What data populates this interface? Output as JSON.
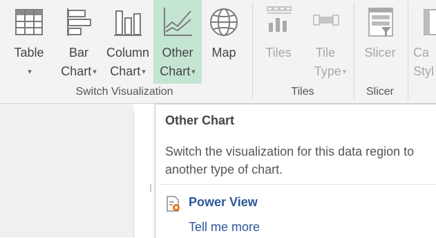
{
  "ribbon": {
    "buttons": [
      {
        "id": "table",
        "icon": "table-icon",
        "l1": "Table",
        "l2": "",
        "caret": true,
        "state": "normal"
      },
      {
        "id": "bar-chart",
        "icon": "bar-chart-icon",
        "l1": "Bar",
        "l2": "Chart",
        "caret": true,
        "state": "normal"
      },
      {
        "id": "column-chart",
        "icon": "column-chart-icon",
        "l1": "Column",
        "l2": "Chart",
        "caret": true,
        "state": "normal"
      },
      {
        "id": "other-chart",
        "icon": "line-chart-icon",
        "l1": "Other",
        "l2": "Chart",
        "caret": true,
        "state": "hover"
      },
      {
        "id": "map",
        "icon": "globe-icon",
        "l1": "Map",
        "l2": "",
        "caret": false,
        "state": "normal"
      },
      {
        "id": "tiles",
        "icon": "tiles-icon",
        "l1": "Tiles",
        "l2": "",
        "caret": false,
        "state": "disabled"
      },
      {
        "id": "tile-type",
        "icon": "tile-type-icon",
        "l1": "Tile",
        "l2": "Type",
        "caret": true,
        "state": "disabled"
      },
      {
        "id": "slicer",
        "icon": "slicer-icon",
        "l1": "Slicer",
        "l2": "",
        "caret": false,
        "state": "disabled"
      },
      {
        "id": "card-style",
        "icon": "card-style-icon",
        "l1": "Ca",
        "l2": "Styl",
        "caret": false,
        "state": "disabled"
      }
    ],
    "groups": {
      "switch_visualization": "Switch Visualization",
      "tiles": "Tiles",
      "slicer": "Slicer"
    },
    "caret_glyph": "▾"
  },
  "tooltip": {
    "title": "Other Chart",
    "description": "Switch the visualization for this data region to another type of chart.",
    "addin_name": "Power View",
    "addin_icon": "power-view-icon",
    "link": "Tell me more"
  },
  "colors": {
    "hover_bg": "#c5e5d3",
    "link": "#2b579a",
    "accent_orange": "#e8721c"
  }
}
